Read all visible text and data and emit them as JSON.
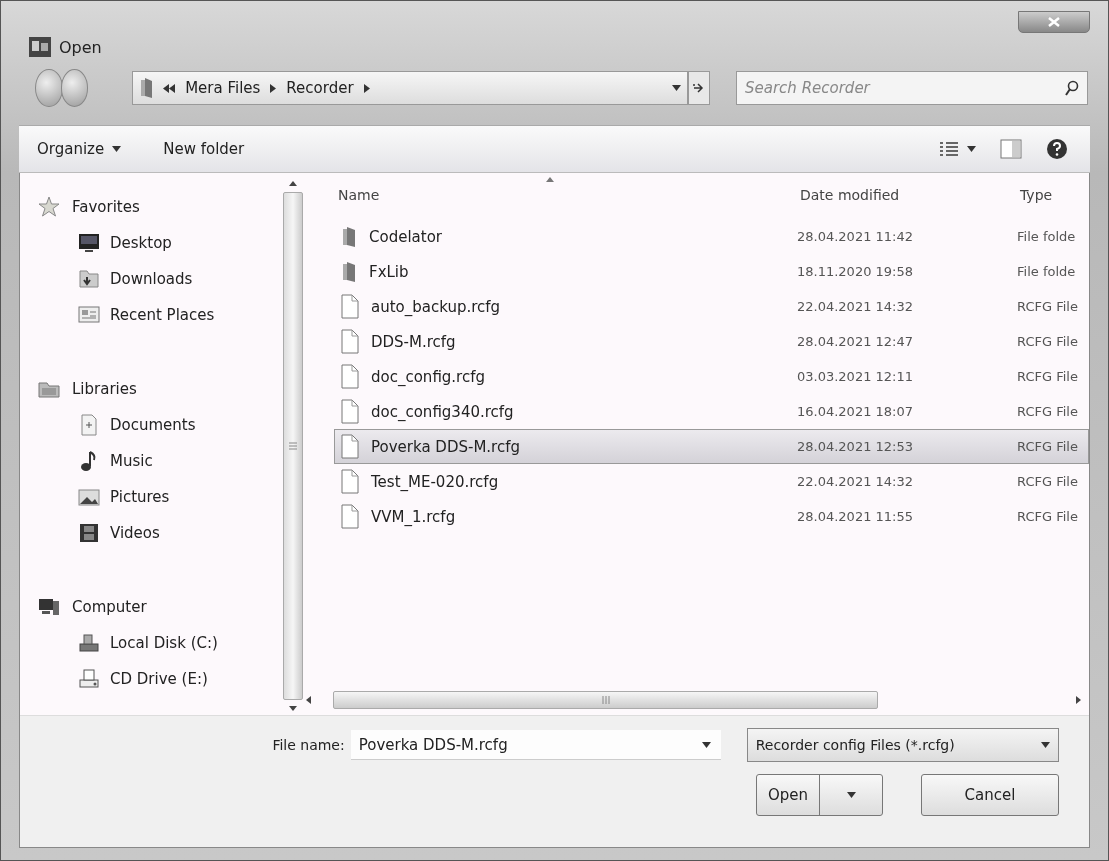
{
  "window": {
    "title": "Open"
  },
  "address": {
    "path": [
      "Mera Files",
      "Recorder"
    ]
  },
  "search": {
    "placeholder": "Search Recorder"
  },
  "toolbar": {
    "organize": "Organize",
    "new_folder": "New folder"
  },
  "navigation": [
    {
      "label": "Favorites",
      "children": [
        {
          "label": "Desktop"
        },
        {
          "label": "Downloads"
        },
        {
          "label": "Recent Places"
        }
      ]
    },
    {
      "label": "Libraries",
      "children": [
        {
          "label": "Documents"
        },
        {
          "label": "Music"
        },
        {
          "label": "Pictures"
        },
        {
          "label": "Videos"
        }
      ]
    },
    {
      "label": "Computer",
      "children": [
        {
          "label": "Local Disk (C:)"
        },
        {
          "label": "CD Drive (E:)"
        }
      ]
    }
  ],
  "file_list": {
    "columns": [
      "Name",
      "Date modified",
      "Type"
    ],
    "rows": [
      {
        "kind": "folder",
        "name": "Codelator",
        "date": "28.04.2021 11:42",
        "type": "File folde",
        "selected": false
      },
      {
        "kind": "folder",
        "name": "FxLib",
        "date": "18.11.2020 19:58",
        "type": "File folde",
        "selected": false
      },
      {
        "kind": "file",
        "name": "auto_backup.rcfg",
        "date": "22.04.2021 14:32",
        "type": "RCFG File",
        "selected": false
      },
      {
        "kind": "file",
        "name": "DDS-M.rcfg",
        "date": "28.04.2021 12:47",
        "type": "RCFG File",
        "selected": false
      },
      {
        "kind": "file",
        "name": "doc_config.rcfg",
        "date": "03.03.2021 12:11",
        "type": "RCFG File",
        "selected": false
      },
      {
        "kind": "file",
        "name": "doc_config340.rcfg",
        "date": "16.04.2021 18:07",
        "type": "RCFG File",
        "selected": false
      },
      {
        "kind": "file",
        "name": "Poverka DDS-M.rcfg",
        "date": "28.04.2021 12:53",
        "type": "RCFG File",
        "selected": true
      },
      {
        "kind": "file",
        "name": "Test_ME-020.rcfg",
        "date": "22.04.2021 14:32",
        "type": "RCFG File",
        "selected": false
      },
      {
        "kind": "file",
        "name": "VVM_1.rcfg",
        "date": "28.04.2021 11:55",
        "type": "RCFG File",
        "selected": false
      }
    ]
  },
  "footer": {
    "file_name_label": "File name:",
    "file_name": "Poverka DDS-M.rcfg",
    "filter": "Recorder config Files (*.rcfg)",
    "buttons": [
      "Open",
      "Cancel"
    ]
  }
}
